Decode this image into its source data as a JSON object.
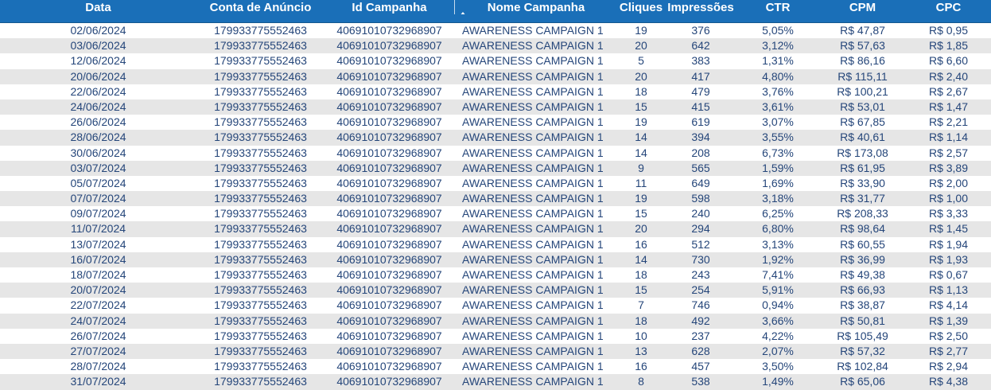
{
  "columns": [
    "Data",
    "Conta de Anúncio",
    "Id Campanha",
    "Nome Campanha",
    "Cliques",
    "Impressões",
    "CTR",
    "CPM",
    "CPC"
  ],
  "sort": {
    "column": "Nome Campanha",
    "direction": "ascending"
  },
  "colors": {
    "header_bg": "#1a6fb8",
    "row_alt": "#e6e6e6",
    "text": "#25467a"
  },
  "rows": [
    [
      "02/06/2024",
      "179933775552463",
      "40691010732968907",
      "AWARENESS CAMPAIGN 1",
      "19",
      "376",
      "5,05%",
      "R$ 47,87",
      "R$ 0,95"
    ],
    [
      "03/06/2024",
      "179933775552463",
      "40691010732968907",
      "AWARENESS CAMPAIGN 1",
      "20",
      "642",
      "3,12%",
      "R$ 57,63",
      "R$ 1,85"
    ],
    [
      "12/06/2024",
      "179933775552463",
      "40691010732968907",
      "AWARENESS CAMPAIGN 1",
      "5",
      "383",
      "1,31%",
      "R$ 86,16",
      "R$ 6,60"
    ],
    [
      "20/06/2024",
      "179933775552463",
      "40691010732968907",
      "AWARENESS CAMPAIGN 1",
      "20",
      "417",
      "4,80%",
      "R$ 115,11",
      "R$ 2,40"
    ],
    [
      "22/06/2024",
      "179933775552463",
      "40691010732968907",
      "AWARENESS CAMPAIGN 1",
      "18",
      "479",
      "3,76%",
      "R$ 100,21",
      "R$ 2,67"
    ],
    [
      "24/06/2024",
      "179933775552463",
      "40691010732968907",
      "AWARENESS CAMPAIGN 1",
      "15",
      "415",
      "3,61%",
      "R$ 53,01",
      "R$ 1,47"
    ],
    [
      "26/06/2024",
      "179933775552463",
      "40691010732968907",
      "AWARENESS CAMPAIGN 1",
      "19",
      "619",
      "3,07%",
      "R$ 67,85",
      "R$ 2,21"
    ],
    [
      "28/06/2024",
      "179933775552463",
      "40691010732968907",
      "AWARENESS CAMPAIGN 1",
      "14",
      "394",
      "3,55%",
      "R$ 40,61",
      "R$ 1,14"
    ],
    [
      "30/06/2024",
      "179933775552463",
      "40691010732968907",
      "AWARENESS CAMPAIGN 1",
      "14",
      "208",
      "6,73%",
      "R$ 173,08",
      "R$ 2,57"
    ],
    [
      "03/07/2024",
      "179933775552463",
      "40691010732968907",
      "AWARENESS CAMPAIGN 1",
      "9",
      "565",
      "1,59%",
      "R$ 61,95",
      "R$ 3,89"
    ],
    [
      "05/07/2024",
      "179933775552463",
      "40691010732968907",
      "AWARENESS CAMPAIGN 1",
      "11",
      "649",
      "1,69%",
      "R$ 33,90",
      "R$ 2,00"
    ],
    [
      "07/07/2024",
      "179933775552463",
      "40691010732968907",
      "AWARENESS CAMPAIGN 1",
      "19",
      "598",
      "3,18%",
      "R$ 31,77",
      "R$ 1,00"
    ],
    [
      "09/07/2024",
      "179933775552463",
      "40691010732968907",
      "AWARENESS CAMPAIGN 1",
      "15",
      "240",
      "6,25%",
      "R$ 208,33",
      "R$ 3,33"
    ],
    [
      "11/07/2024",
      "179933775552463",
      "40691010732968907",
      "AWARENESS CAMPAIGN 1",
      "20",
      "294",
      "6,80%",
      "R$ 98,64",
      "R$ 1,45"
    ],
    [
      "13/07/2024",
      "179933775552463",
      "40691010732968907",
      "AWARENESS CAMPAIGN 1",
      "16",
      "512",
      "3,13%",
      "R$ 60,55",
      "R$ 1,94"
    ],
    [
      "16/07/2024",
      "179933775552463",
      "40691010732968907",
      "AWARENESS CAMPAIGN 1",
      "14",
      "730",
      "1,92%",
      "R$ 36,99",
      "R$ 1,93"
    ],
    [
      "18/07/2024",
      "179933775552463",
      "40691010732968907",
      "AWARENESS CAMPAIGN 1",
      "18",
      "243",
      "7,41%",
      "R$ 49,38",
      "R$ 0,67"
    ],
    [
      "20/07/2024",
      "179933775552463",
      "40691010732968907",
      "AWARENESS CAMPAIGN 1",
      "15",
      "254",
      "5,91%",
      "R$ 66,93",
      "R$ 1,13"
    ],
    [
      "22/07/2024",
      "179933775552463",
      "40691010732968907",
      "AWARENESS CAMPAIGN 1",
      "7",
      "746",
      "0,94%",
      "R$ 38,87",
      "R$ 4,14"
    ],
    [
      "24/07/2024",
      "179933775552463",
      "40691010732968907",
      "AWARENESS CAMPAIGN 1",
      "18",
      "492",
      "3,66%",
      "R$ 50,81",
      "R$ 1,39"
    ],
    [
      "26/07/2024",
      "179933775552463",
      "40691010732968907",
      "AWARENESS CAMPAIGN 1",
      "10",
      "237",
      "4,22%",
      "R$ 105,49",
      "R$ 2,50"
    ],
    [
      "27/07/2024",
      "179933775552463",
      "40691010732968907",
      "AWARENESS CAMPAIGN 1",
      "13",
      "628",
      "2,07%",
      "R$ 57,32",
      "R$ 2,77"
    ],
    [
      "28/07/2024",
      "179933775552463",
      "40691010732968907",
      "AWARENESS CAMPAIGN 1",
      "16",
      "457",
      "3,50%",
      "R$ 102,84",
      "R$ 2,94"
    ],
    [
      "31/07/2024",
      "179933775552463",
      "40691010732968907",
      "AWARENESS CAMPAIGN 1",
      "8",
      "538",
      "1,49%",
      "R$ 65,06",
      "R$ 4,38"
    ]
  ]
}
